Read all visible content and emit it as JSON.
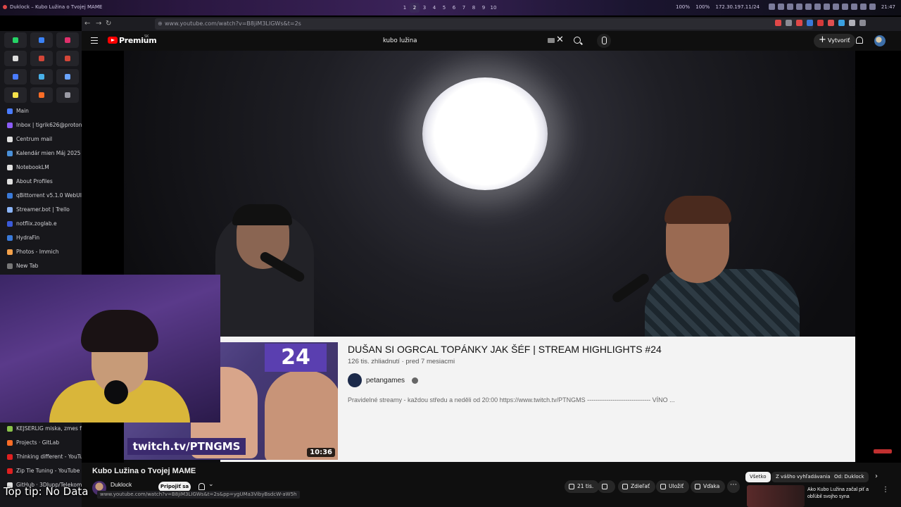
{
  "system_bar": {
    "window_title": "Duklock – Kubo Lužina o Tvojej MAME",
    "workspaces": [
      "1",
      "2",
      "3",
      "4",
      "5",
      "6",
      "7",
      "8",
      "9",
      "10"
    ],
    "active_workspace": "2",
    "stats": [
      "100%",
      "100%",
      "172.30.197.11/24"
    ],
    "clock": "21:47"
  },
  "browser": {
    "url": "www.youtube.com/watch?v=B8jiM3LIGWs&t=2s"
  },
  "sidebar": {
    "pinned": [
      {
        "icon": "whatsapp-icon",
        "color": "#25d366"
      },
      {
        "icon": "messenger-icon",
        "color": "#3b82f6"
      },
      {
        "icon": "instagram-icon",
        "color": "#e1306c"
      },
      {
        "icon": "x-icon",
        "color": "#dddddd"
      },
      {
        "icon": "gmail-icon",
        "color": "#d44638"
      },
      {
        "icon": "gmail-icon",
        "color": "#d44638"
      },
      {
        "icon": "chat-icon",
        "color": "#4a7cff"
      },
      {
        "icon": "cloud-icon",
        "color": "#48b0e8"
      },
      {
        "icon": "docs-icon",
        "color": "#6aa4ff"
      },
      {
        "icon": "notes-icon",
        "color": "#f4e14a"
      },
      {
        "icon": "gitlab-icon",
        "color": "#fc6d26"
      },
      {
        "icon": "settings-icon",
        "color": "#9a9aa4"
      }
    ],
    "tabs": [
      {
        "label": "Main",
        "color": "#4a7cff"
      },
      {
        "label": "Inbox | tigrik626@protonmail",
        "color": "#8b5cf6"
      },
      {
        "label": "Centrum mail",
        "color": "#e0e0e0"
      },
      {
        "label": "Kalendár mien Máj 2025 –",
        "color": "#4a90d9"
      },
      {
        "label": "NotebookLM",
        "color": "#e0e0e0"
      },
      {
        "label": "About Profiles",
        "color": "#e0e0e0"
      },
      {
        "label": "qBittorrent v5.1.0 WebUI",
        "color": "#3a7ad9"
      },
      {
        "label": "Streamer.bot | Trello",
        "color": "#8ab4f8"
      },
      {
        "label": "notflix.zoglab.e",
        "color": "#3a5ad9"
      },
      {
        "label": "HydraFin",
        "color": "#3a7ad9"
      },
      {
        "label": "Photos - Immich",
        "color": "#f4a14a"
      },
      {
        "label": "New Tab",
        "color": "#777777"
      }
    ],
    "lower_tabs": [
      {
        "label": "KEJSERLIG miska, zmes farieb",
        "color": "#8bc34a"
      },
      {
        "label": "Projects · GitLab",
        "color": "#fc6d26"
      },
      {
        "label": "Thinking different - YouTube",
        "color": "#e02020"
      },
      {
        "label": "Zip Tie Tuning - YouTube",
        "color": "#e02020"
      },
      {
        "label": "GitHub · 3DJupp/Telekom",
        "color": "#e0e0e0"
      }
    ]
  },
  "youtube": {
    "brand": "Premium",
    "region": "SK",
    "search_query": "kubo lužina",
    "create_label": "Vytvoriť"
  },
  "end_card": {
    "episode": "24",
    "twitch": "twitch.tv/PTNGMS",
    "duration": "10:36",
    "title": "DUŠAN SI OGRCAL TOPÁNKY JAK ŠÉF | STREAM HIGHLIGHTS #24",
    "meta": "126 tis. zhliadnutí · pred 7 mesiacmi",
    "channel": "petangames",
    "description": "Pravidelné streamy - každou středu a neděli od 20:00 https://www.twitch.tv/PTNGMS ------------------------------ VÍNO ..."
  },
  "video_info": {
    "title": "Kubo Lužina o Tvojej MAME",
    "channel": "Duklock",
    "join_label": "Pripojiť sa",
    "likes": "21 tis.",
    "share_label": "Zdieľať",
    "save_label": "Uložiť",
    "thanks_label": "Vďaka"
  },
  "chips": [
    "Všetko",
    "Z vášho vyhľadávania",
    "Od: Duklock"
  ],
  "recommendation": {
    "title": "Ako Kubo Lužina začal piť a obľúbil svojho syna"
  },
  "status_url": "www.youtube.com/watch?v=B8jiM3LIGWs&t=2s&pp=ygUMa3VibyBsdcW-aW5h",
  "tooltip": "Top tip: No Data"
}
